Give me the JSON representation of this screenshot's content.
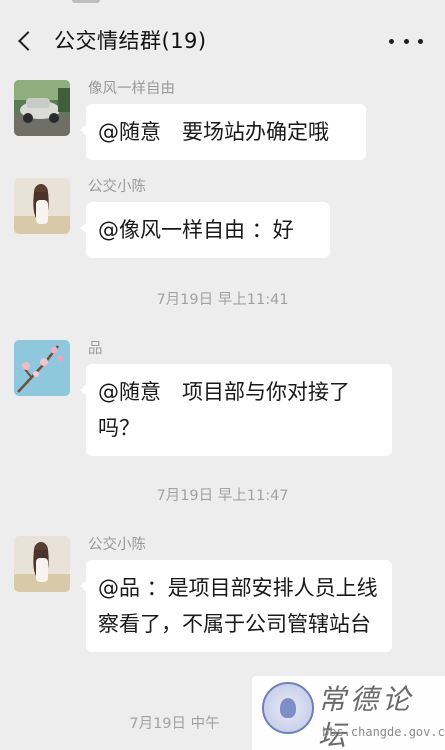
{
  "header": {
    "title": "公交情结群(19)"
  },
  "messages": [
    {
      "sender": "像风一样自由",
      "text": "@随意　要场站办确定哦",
      "avatar": "car-photo-avatar"
    },
    {
      "sender": "公交小陈",
      "text": "@像风一样自由 ：好",
      "avatar": "girl-photo-avatar"
    },
    {
      "sender": "品",
      "text": "@随意　项目部与你对接了吗？",
      "avatar": "blossom-photo-avatar"
    },
    {
      "sender": "公交小陈",
      "text": "@品 ：是项目部安排人员上线察看了，不属于公司管辖站台",
      "avatar": "girl-photo-avatar"
    }
  ],
  "timestamps": [
    "7月19日 早上11:41",
    "7月19日 早上11:47",
    "7月19日 中午"
  ],
  "watermark": {
    "title": "常德论坛",
    "url": "bbs.changde.gov.cn"
  },
  "colors": {
    "background": "#ededed",
    "bubble": "#ffffff",
    "meta_text": "#9a9a9a"
  }
}
